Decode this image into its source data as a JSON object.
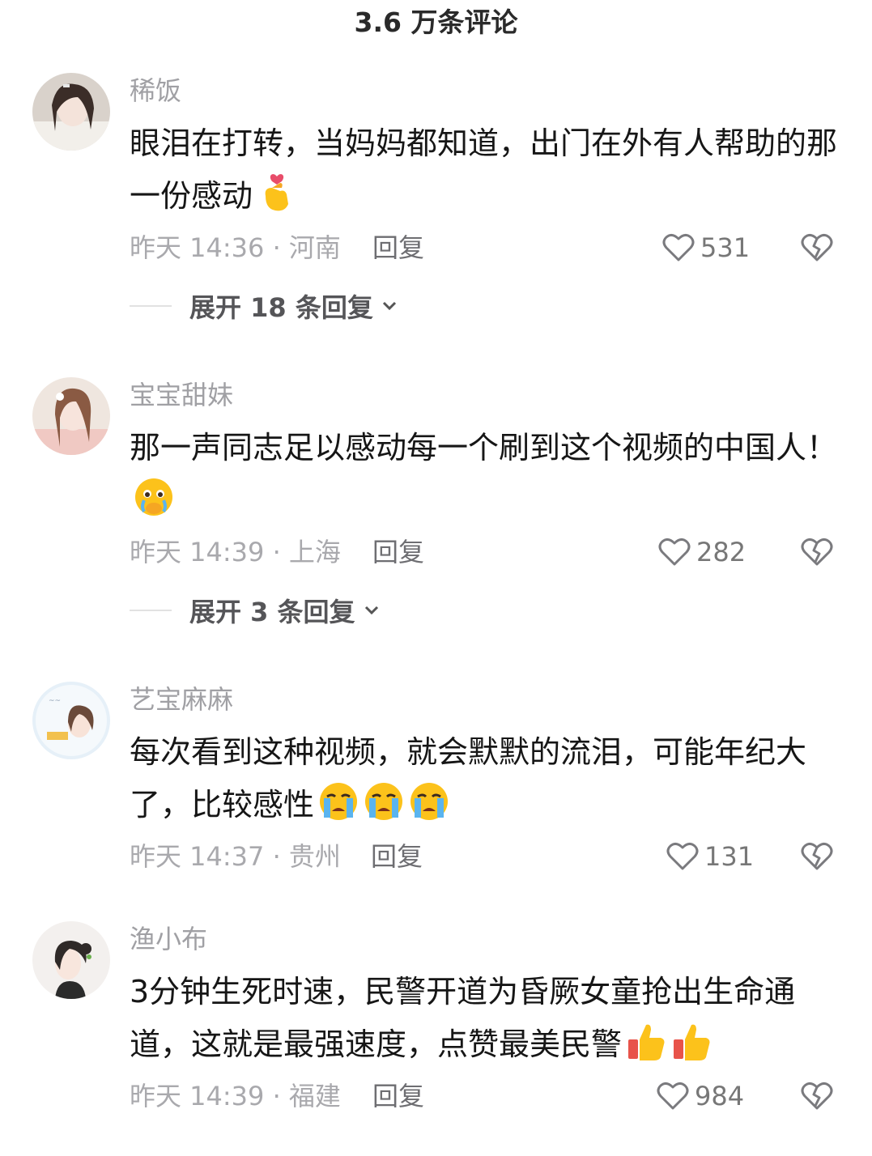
{
  "header": {
    "title": "3.6 万条评论"
  },
  "comments": [
    {
      "username": "稀饭",
      "text": "眼泪在打转，当妈妈都知道，出门在外有人帮助的那一份感动",
      "meta": "昨天 14:36 · 河南",
      "reply_label": "回复",
      "likes": "531",
      "expand_label": "展开 18 条回复"
    },
    {
      "username": "宝宝甜妹",
      "text": "那一声同志足以感动每一个刷到这个视频的中国人！",
      "meta": "昨天 14:39 · 上海",
      "reply_label": "回复",
      "likes": "282",
      "expand_label": "展开 3 条回复"
    },
    {
      "username": "艺宝麻麻",
      "text": "每次看到这种视频，就会默默的流泪，可能年纪大了，比较感性",
      "meta": "昨天 14:37 · 贵州",
      "reply_label": "回复",
      "likes": "131"
    },
    {
      "username": "渔小布",
      "text": "3分钟生死时速，民警开道为昏厥女童抢出生命通道，这就是最强速度，点赞最美民警",
      "meta": "昨天 14:39 · 福建",
      "reply_label": "回复",
      "likes": "984"
    }
  ],
  "icons": {
    "like": "heart-outline-icon",
    "dislike": "broken-heart-icon",
    "expand": "chevron-down-icon"
  },
  "colors": {
    "text": "#161616",
    "muted": "#a9a9ad",
    "reply": "#6e6e72"
  }
}
